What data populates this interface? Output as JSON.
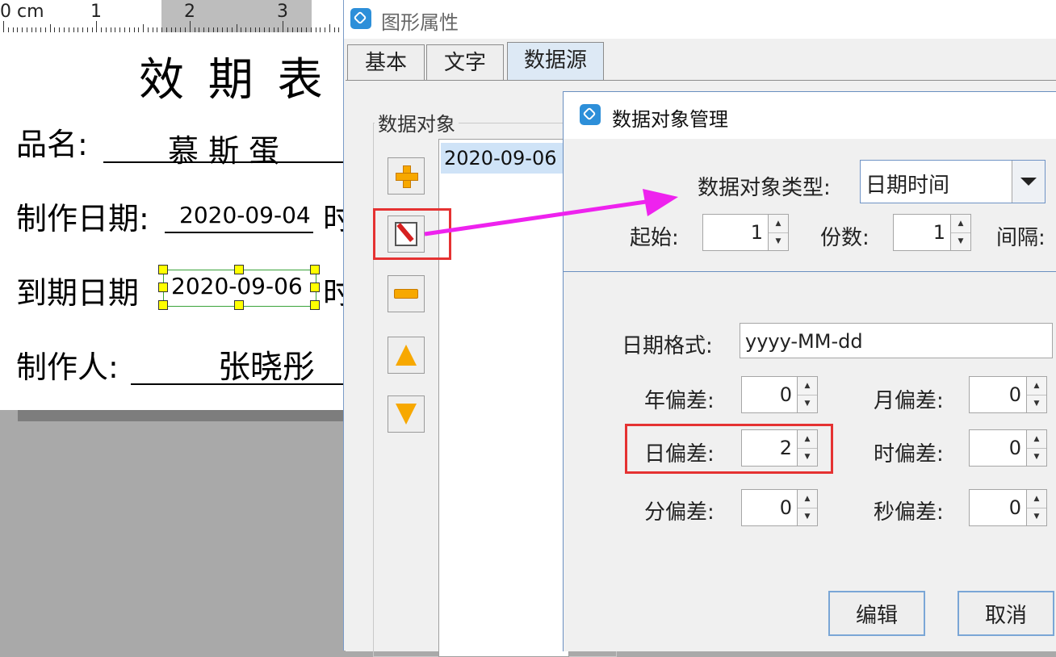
{
  "ruler": {
    "unit": "0 cm",
    "marks": [
      "1",
      "2",
      "3"
    ]
  },
  "label": {
    "title": "效 期 表",
    "product_label": "品名:",
    "product_value": "慕 斯 蛋",
    "made_label": "制作日期:",
    "made_value": "2020-09-04",
    "made_suffix": "时",
    "expire_label": "到期日期",
    "expire_value": "2020-09-06",
    "expire_suffix": "时",
    "maker_label": "制作人:",
    "maker_value": "张晓彤"
  },
  "props_window": {
    "title": "图形属性",
    "tabs": [
      {
        "label": "基本"
      },
      {
        "label": "文字"
      },
      {
        "label": "数据源"
      }
    ],
    "active_tab": "数据源",
    "group_label": "数据对象",
    "list_items": [
      "2020-09-06"
    ],
    "side_buttons": [
      "add-icon",
      "edit-icon",
      "remove-icon",
      "move-up-icon",
      "move-down-icon"
    ]
  },
  "dialog": {
    "title": "数据对象管理",
    "type_label": "数据对象类型:",
    "type_value": "日期时间",
    "start_label": "起始:",
    "start_value": "1",
    "copies_label": "份数:",
    "copies_value": "1",
    "interval_label": "间隔:",
    "format_label": "日期格式:",
    "format_value": "yyyy-MM-dd",
    "year_label": "年偏差:",
    "year_value": "0",
    "month_label": "月偏差:",
    "month_value": "0",
    "day_label": "日偏差:",
    "day_value": "2",
    "hour_label": "时偏差:",
    "hour_value": "0",
    "minute_label": "分偏差:",
    "minute_value": "0",
    "second_label": "秒偏差:",
    "second_value": "0",
    "edit_button": "编辑",
    "cancel_button": "取消"
  },
  "colors": {
    "highlight": "#e53232",
    "arrow": "#ee22ee",
    "handle": "#ffff00",
    "accent": "#2d8fd9"
  }
}
